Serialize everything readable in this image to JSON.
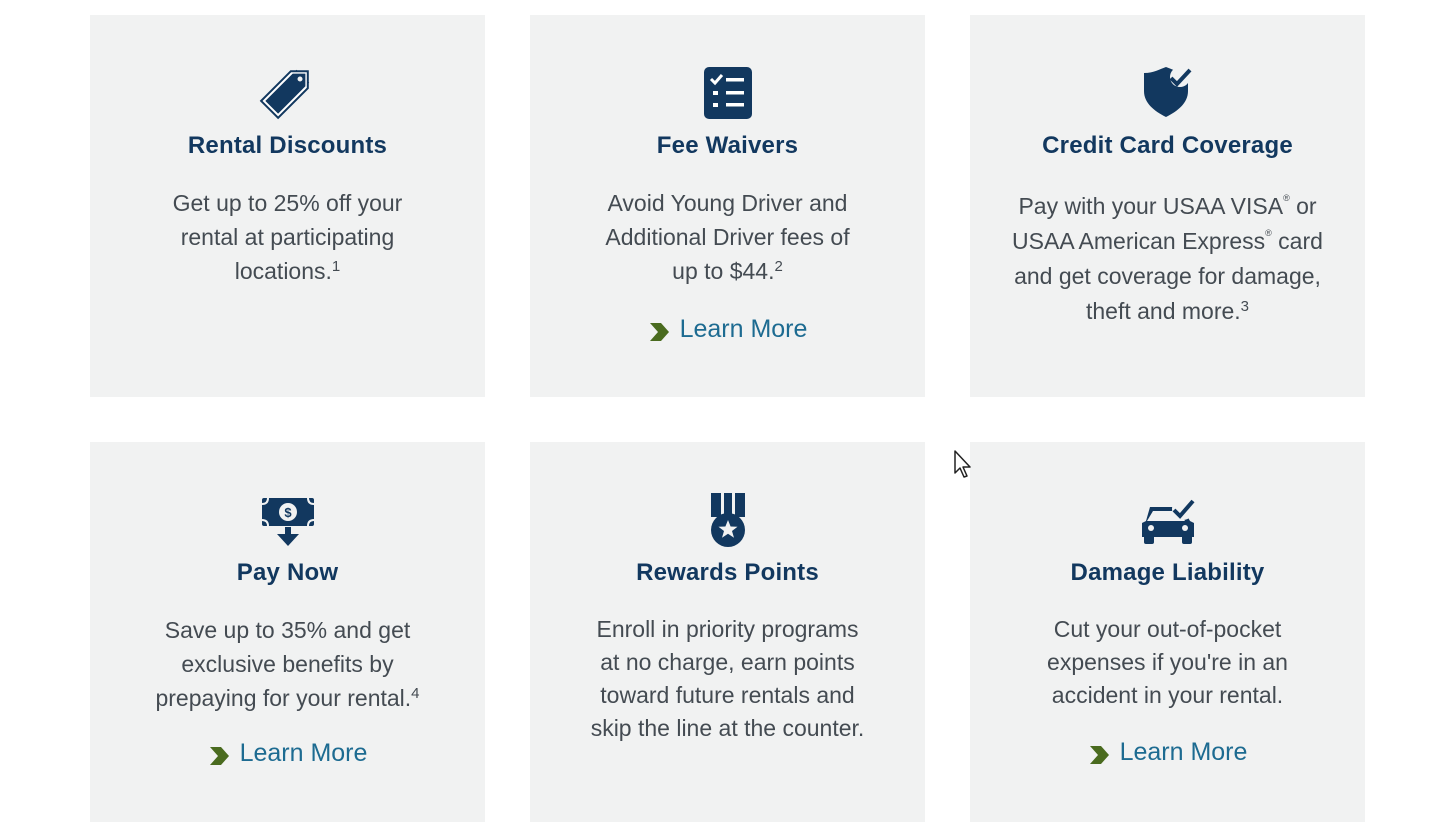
{
  "colors": {
    "card_bg": "#f1f2f2",
    "title": "#12385f",
    "body_text": "#444b52",
    "link": "#1d6b91",
    "chevron": "#4a6b1f",
    "icon": "#12385f"
  },
  "cards": [
    {
      "icon": "price-tag-icon",
      "title": "Rental Discounts",
      "desc_line1": "Get up to 25% off your",
      "desc_line2": "rental at participating",
      "desc_line3": "locations.",
      "footnote": "1"
    },
    {
      "icon": "checklist-icon",
      "title": "Fee Waivers",
      "desc_line1": "Avoid Young Driver and",
      "desc_line2": "Additional Driver fees of",
      "desc_line3": "up to $44.",
      "footnote": "2",
      "link": "Learn More"
    },
    {
      "icon": "shield-check-icon",
      "title": "Credit Card Coverage",
      "desc_line1a": "Pay with your USAA VISA",
      "reg1": "®",
      "desc_line1b": " or",
      "desc_line2a": "USAA American Express",
      "reg2": "®",
      "desc_line2b": " card",
      "desc_line3": "and get coverage for damage,",
      "desc_line4": "theft and more.",
      "footnote": "3"
    },
    {
      "icon": "money-download-icon",
      "title": "Pay Now",
      "desc_line1": "Save up to 35% and get",
      "desc_line2": "exclusive benefits by",
      "desc_line3": "prepaying for your rental.",
      "footnote": "4",
      "link": "Learn More"
    },
    {
      "icon": "medal-star-icon",
      "title": "Rewards Points",
      "desc_line1": "Enroll in priority programs",
      "desc_line2": "at no charge, earn points",
      "desc_line3": "toward future rentals and",
      "desc_line4": "skip the line at the counter."
    },
    {
      "icon": "car-check-icon",
      "title": "Damage Liability",
      "desc_line1": "Cut your out-of-pocket",
      "desc_line2": "expenses if you're in an",
      "desc_line3": "accident in your rental.",
      "link": "Learn More"
    }
  ]
}
